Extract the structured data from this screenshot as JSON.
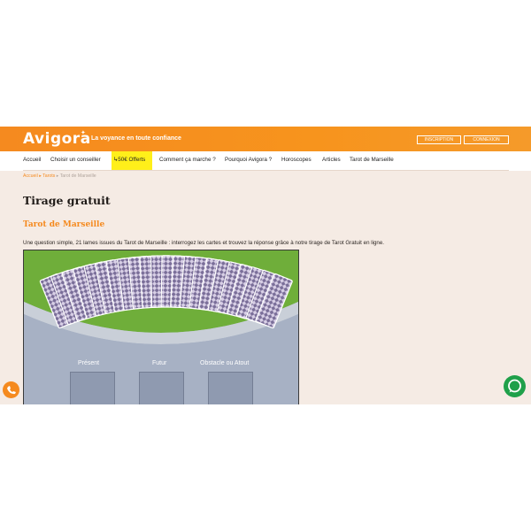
{
  "header": {
    "logo_text": "Avigora",
    "tagline": "La voyance en toute confiance",
    "signup_label": "INSCRIPTION",
    "login_label": "CONNEXION",
    "bg_color": "#f7941d"
  },
  "nav": {
    "items": [
      {
        "label": "Accueil"
      },
      {
        "label": "Choisir un conseiller"
      },
      {
        "label": "50€ Offerts"
      },
      {
        "label": "Comment ça marche ?"
      },
      {
        "label": "Pourquoi Avigora ?"
      },
      {
        "label": "Horoscopes"
      },
      {
        "label": "Articles"
      },
      {
        "label": "Tarot de Marseille"
      }
    ],
    "offer_highlight_color": "#ffef1a"
  },
  "breadcrumb": {
    "items": [
      "Accueil",
      "Tarots",
      "Tarot de Marseille"
    ],
    "separator": "▸"
  },
  "page": {
    "title": "Tirage gratuit",
    "subtitle": "Tarot de Marseille",
    "intro": "Une question simple, 21 lames issues du Tarot de Marseille : interrogez les cartes et trouvez la réponse grâce à notre tirage de Tarot Gratuit en ligne."
  },
  "game": {
    "card_count": 21,
    "positions": [
      "Présent",
      "Futur",
      "Obstacle ou Atout"
    ],
    "table_color": "#6fae3a",
    "board_color": "#a7b1c4"
  },
  "widgets": {
    "left_fab": "phone-icon",
    "right_fab": "chat-icon"
  }
}
